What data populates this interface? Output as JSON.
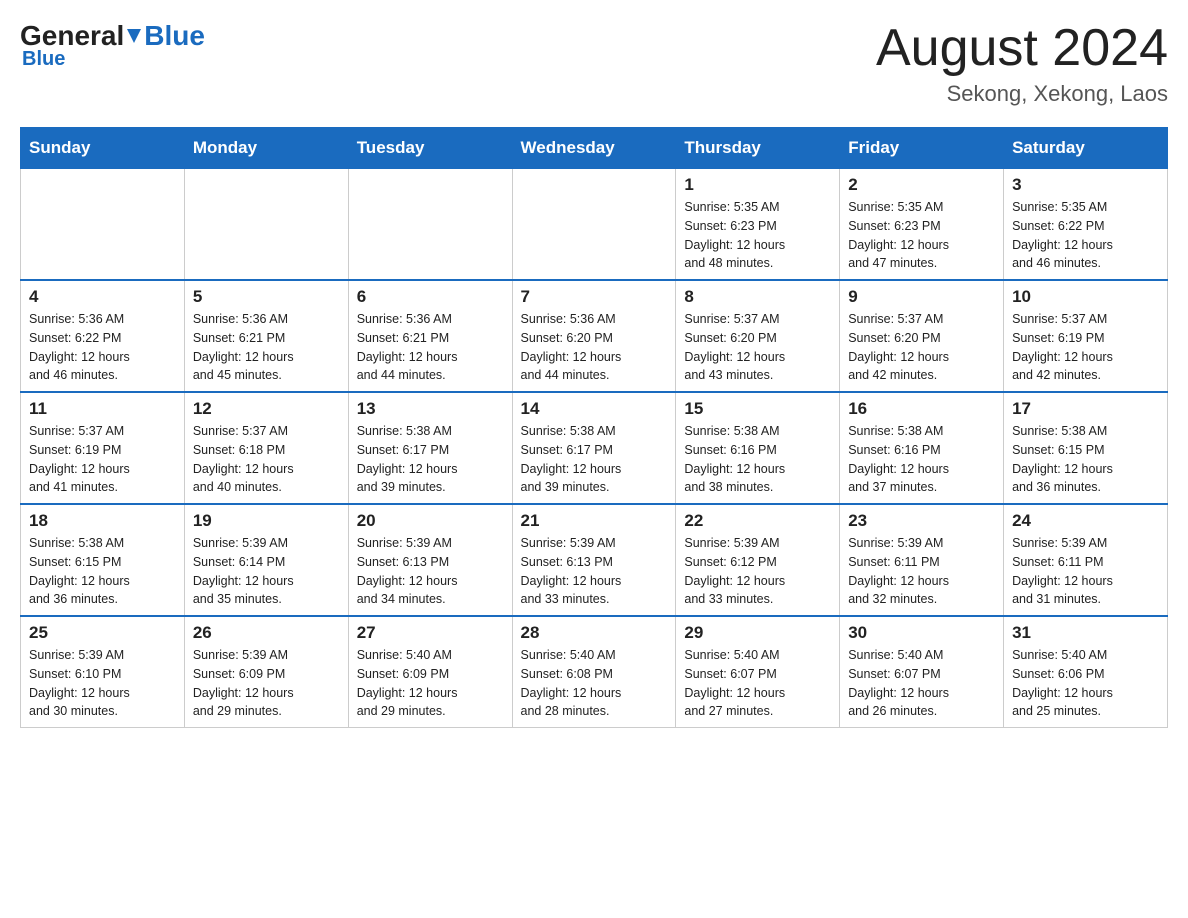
{
  "header": {
    "logo_general": "General",
    "logo_blue": "Blue",
    "calendar_title": "August 2024",
    "calendar_subtitle": "Sekong, Xekong, Laos"
  },
  "weekdays": [
    "Sunday",
    "Monday",
    "Tuesday",
    "Wednesday",
    "Thursday",
    "Friday",
    "Saturday"
  ],
  "weeks": [
    [
      {
        "day": "",
        "info": ""
      },
      {
        "day": "",
        "info": ""
      },
      {
        "day": "",
        "info": ""
      },
      {
        "day": "",
        "info": ""
      },
      {
        "day": "1",
        "info": "Sunrise: 5:35 AM\nSunset: 6:23 PM\nDaylight: 12 hours\nand 48 minutes."
      },
      {
        "day": "2",
        "info": "Sunrise: 5:35 AM\nSunset: 6:23 PM\nDaylight: 12 hours\nand 47 minutes."
      },
      {
        "day": "3",
        "info": "Sunrise: 5:35 AM\nSunset: 6:22 PM\nDaylight: 12 hours\nand 46 minutes."
      }
    ],
    [
      {
        "day": "4",
        "info": "Sunrise: 5:36 AM\nSunset: 6:22 PM\nDaylight: 12 hours\nand 46 minutes."
      },
      {
        "day": "5",
        "info": "Sunrise: 5:36 AM\nSunset: 6:21 PM\nDaylight: 12 hours\nand 45 minutes."
      },
      {
        "day": "6",
        "info": "Sunrise: 5:36 AM\nSunset: 6:21 PM\nDaylight: 12 hours\nand 44 minutes."
      },
      {
        "day": "7",
        "info": "Sunrise: 5:36 AM\nSunset: 6:20 PM\nDaylight: 12 hours\nand 44 minutes."
      },
      {
        "day": "8",
        "info": "Sunrise: 5:37 AM\nSunset: 6:20 PM\nDaylight: 12 hours\nand 43 minutes."
      },
      {
        "day": "9",
        "info": "Sunrise: 5:37 AM\nSunset: 6:20 PM\nDaylight: 12 hours\nand 42 minutes."
      },
      {
        "day": "10",
        "info": "Sunrise: 5:37 AM\nSunset: 6:19 PM\nDaylight: 12 hours\nand 42 minutes."
      }
    ],
    [
      {
        "day": "11",
        "info": "Sunrise: 5:37 AM\nSunset: 6:19 PM\nDaylight: 12 hours\nand 41 minutes."
      },
      {
        "day": "12",
        "info": "Sunrise: 5:37 AM\nSunset: 6:18 PM\nDaylight: 12 hours\nand 40 minutes."
      },
      {
        "day": "13",
        "info": "Sunrise: 5:38 AM\nSunset: 6:17 PM\nDaylight: 12 hours\nand 39 minutes."
      },
      {
        "day": "14",
        "info": "Sunrise: 5:38 AM\nSunset: 6:17 PM\nDaylight: 12 hours\nand 39 minutes."
      },
      {
        "day": "15",
        "info": "Sunrise: 5:38 AM\nSunset: 6:16 PM\nDaylight: 12 hours\nand 38 minutes."
      },
      {
        "day": "16",
        "info": "Sunrise: 5:38 AM\nSunset: 6:16 PM\nDaylight: 12 hours\nand 37 minutes."
      },
      {
        "day": "17",
        "info": "Sunrise: 5:38 AM\nSunset: 6:15 PM\nDaylight: 12 hours\nand 36 minutes."
      }
    ],
    [
      {
        "day": "18",
        "info": "Sunrise: 5:38 AM\nSunset: 6:15 PM\nDaylight: 12 hours\nand 36 minutes."
      },
      {
        "day": "19",
        "info": "Sunrise: 5:39 AM\nSunset: 6:14 PM\nDaylight: 12 hours\nand 35 minutes."
      },
      {
        "day": "20",
        "info": "Sunrise: 5:39 AM\nSunset: 6:13 PM\nDaylight: 12 hours\nand 34 minutes."
      },
      {
        "day": "21",
        "info": "Sunrise: 5:39 AM\nSunset: 6:13 PM\nDaylight: 12 hours\nand 33 minutes."
      },
      {
        "day": "22",
        "info": "Sunrise: 5:39 AM\nSunset: 6:12 PM\nDaylight: 12 hours\nand 33 minutes."
      },
      {
        "day": "23",
        "info": "Sunrise: 5:39 AM\nSunset: 6:11 PM\nDaylight: 12 hours\nand 32 minutes."
      },
      {
        "day": "24",
        "info": "Sunrise: 5:39 AM\nSunset: 6:11 PM\nDaylight: 12 hours\nand 31 minutes."
      }
    ],
    [
      {
        "day": "25",
        "info": "Sunrise: 5:39 AM\nSunset: 6:10 PM\nDaylight: 12 hours\nand 30 minutes."
      },
      {
        "day": "26",
        "info": "Sunrise: 5:39 AM\nSunset: 6:09 PM\nDaylight: 12 hours\nand 29 minutes."
      },
      {
        "day": "27",
        "info": "Sunrise: 5:40 AM\nSunset: 6:09 PM\nDaylight: 12 hours\nand 29 minutes."
      },
      {
        "day": "28",
        "info": "Sunrise: 5:40 AM\nSunset: 6:08 PM\nDaylight: 12 hours\nand 28 minutes."
      },
      {
        "day": "29",
        "info": "Sunrise: 5:40 AM\nSunset: 6:07 PM\nDaylight: 12 hours\nand 27 minutes."
      },
      {
        "day": "30",
        "info": "Sunrise: 5:40 AM\nSunset: 6:07 PM\nDaylight: 12 hours\nand 26 minutes."
      },
      {
        "day": "31",
        "info": "Sunrise: 5:40 AM\nSunset: 6:06 PM\nDaylight: 12 hours\nand 25 minutes."
      }
    ]
  ]
}
